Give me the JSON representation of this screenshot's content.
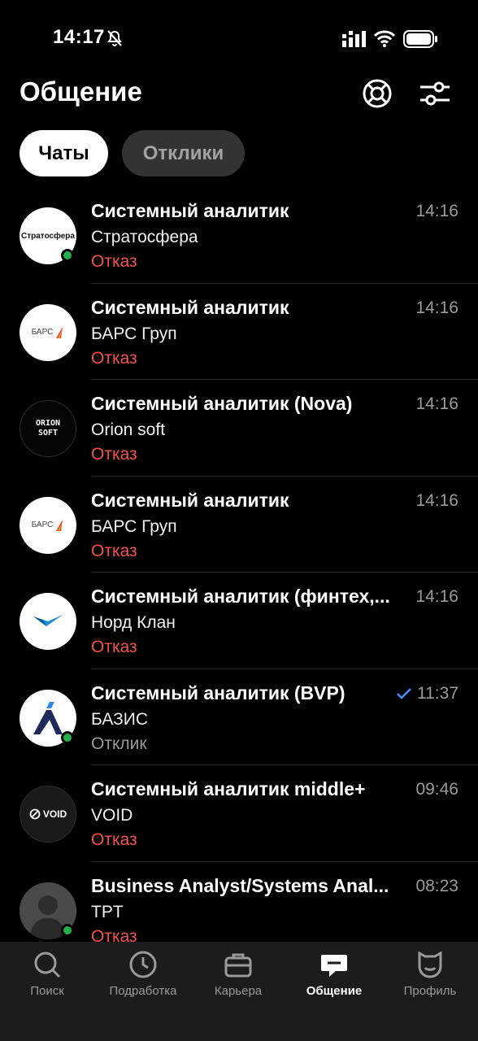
{
  "status_bar": {
    "time": "14:17"
  },
  "header": {
    "title": "Общение"
  },
  "tabs": [
    {
      "label": "Чаты",
      "active": true
    },
    {
      "label": "Отклики",
      "active": false
    }
  ],
  "chats": [
    {
      "title": "Системный аналитик",
      "company": "Стратосфера",
      "status": "Отказ",
      "time": "14:16",
      "logo_text": "Стратосфера",
      "online": true
    },
    {
      "title": "Системный аналитик",
      "company": "БАРС Груп",
      "status": "Отказ",
      "time": "14:16",
      "logo_text": "БАРС",
      "online": false
    },
    {
      "title": "Системный аналитик (Nova)",
      "company": "Orion soft",
      "status": "Отказ",
      "time": "14:16",
      "logo_text": "ORION SOFT",
      "online": false
    },
    {
      "title": "Системный аналитик",
      "company": "БАРС Груп",
      "status": "Отказ",
      "time": "14:16",
      "logo_text": "БАРС",
      "online": false
    },
    {
      "title": "Системный аналитик (финтех,...",
      "company": "Норд Клан",
      "status": "Отказ",
      "time": "14:16",
      "online": false
    },
    {
      "title": "Системный аналитик (BVP)",
      "company": "БАЗИС",
      "status": "Отклик",
      "time": "11:37",
      "read": true,
      "online": true
    },
    {
      "title": "Системный аналитик middle+",
      "company": "VOID",
      "status": "Отказ",
      "time": "09:46",
      "logo_text": "VOID",
      "online": false
    },
    {
      "title": "Business Analyst/Systems Anal...",
      "company": "TPT",
      "status": "Отказ",
      "time": "08:23",
      "online": true
    }
  ],
  "nav": [
    {
      "label": "Поиск",
      "icon": "search-icon"
    },
    {
      "label": "Подработка",
      "icon": "clock-icon"
    },
    {
      "label": "Карьера",
      "icon": "briefcase-icon"
    },
    {
      "label": "Общение",
      "icon": "chat-icon",
      "active": true
    },
    {
      "label": "Профиль",
      "icon": "profile-icon"
    }
  ],
  "colors": {
    "reject": "#f2524e",
    "online": "#22b04c",
    "check": "#4a8cff"
  }
}
